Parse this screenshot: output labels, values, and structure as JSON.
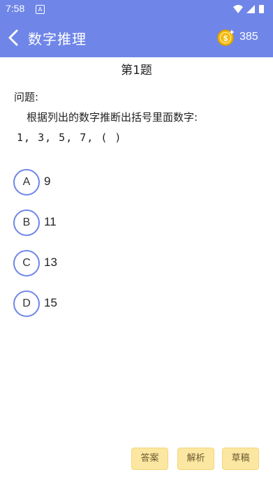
{
  "status": {
    "time": "7:58",
    "badge": "A"
  },
  "header": {
    "title": "数字推理",
    "coins": "385"
  },
  "question": {
    "title": "第1题",
    "label": "问题:",
    "text": "根据列出的数字推断出括号里面数字:",
    "sequence": "1, 3, 5, 7, ( )"
  },
  "options": [
    {
      "letter": "A",
      "value": "9"
    },
    {
      "letter": "B",
      "value": "11"
    },
    {
      "letter": "C",
      "value": "13"
    },
    {
      "letter": "D",
      "value": "15"
    }
  ],
  "buttons": {
    "answer": "答案",
    "analysis": "解析",
    "draft": "草稿"
  },
  "colors": {
    "primary": "#6f86e8",
    "button_bg": "#fbe7a1",
    "coin": "#f2b90f"
  }
}
